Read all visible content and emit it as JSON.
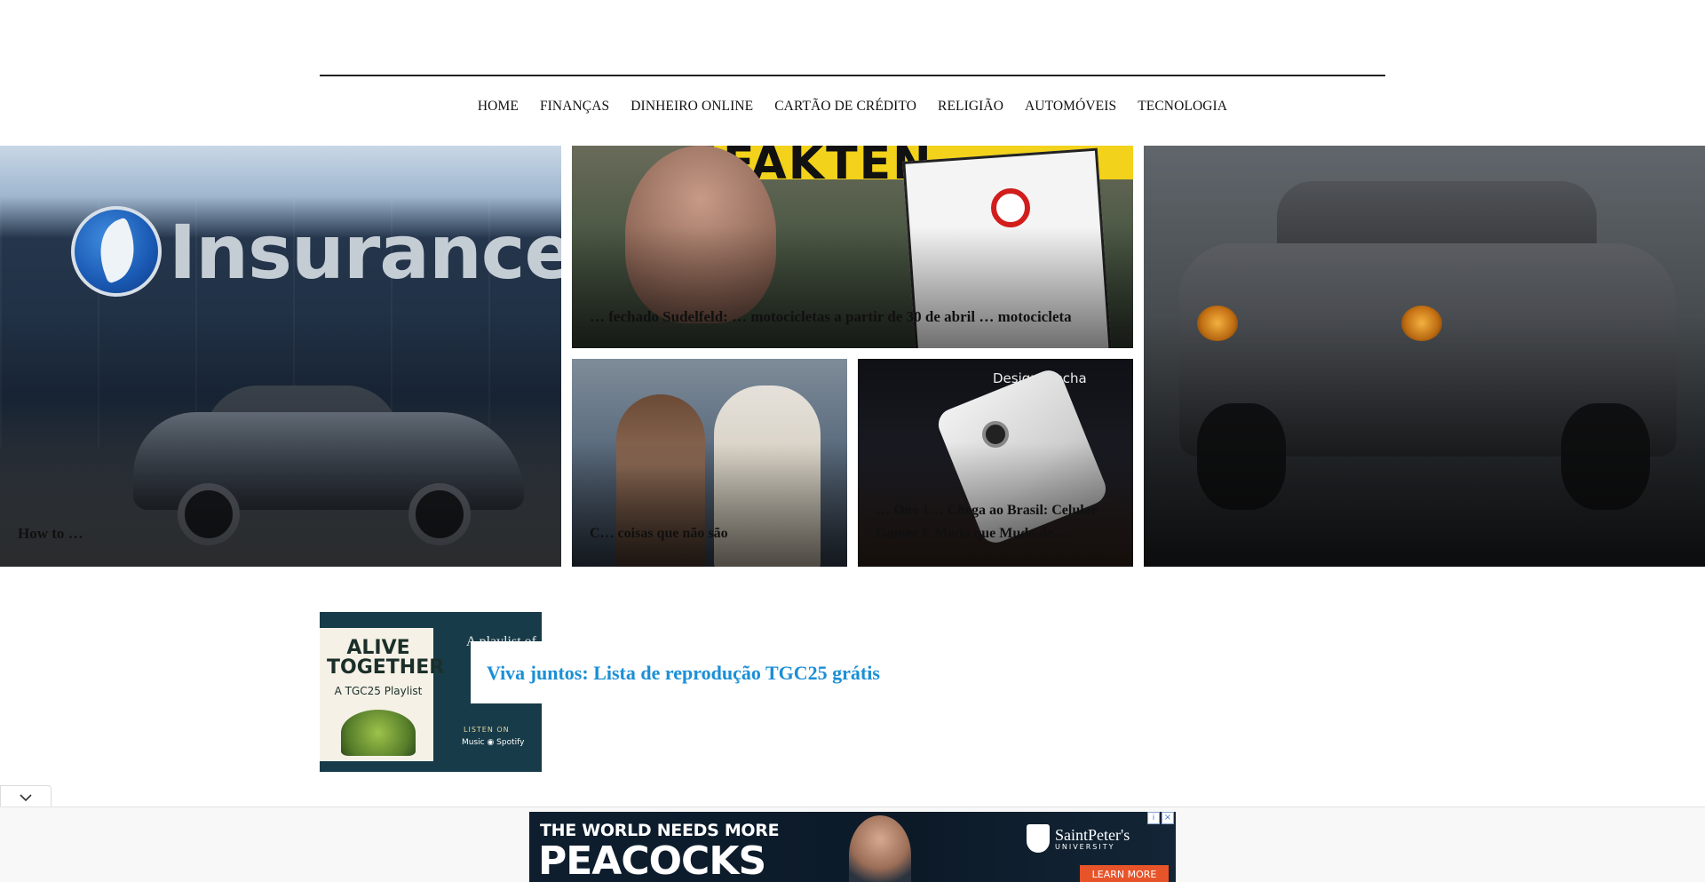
{
  "nav": {
    "items": [
      "HOME",
      "FINANÇAS",
      "DINHEIRO ONLINE",
      "CARTÃO DE CRÉDITO",
      "RELIGIÃO",
      "AUTOMÓVEIS",
      "TECNOLOGIA"
    ]
  },
  "hero": {
    "tiles": [
      {
        "caption": "How to …",
        "logo_text": "Insurance"
      },
      {
        "caption": "… fechado Sudelfeld: … motocicletas a partir de 30 de abril … motocicleta",
        "banner_text": "FAKTEN"
      },
      {
        "caption": "C… coisas que não são"
      },
      {
        "caption": "… One 1… Chega ao Brasil: Celular Gamer E Modo que Muda de…",
        "overlay_text": "Design Mecha"
      },
      {
        "caption": ""
      }
    ]
  },
  "featured": {
    "title": "Viva juntos: Lista de reprodução TGC25 grátis",
    "image_text": {
      "title_line": "ALIVE TOGETHER",
      "subtitle": "A TGC25 Playlist",
      "side_text": "A playlist of the theme.",
      "listen": "LISTEN ON",
      "services": " Music  ◉ Spotify"
    }
  },
  "ad": {
    "line1": "THE WORLD NEEDS MORE",
    "line2": "PEACOCKS",
    "university": "SaintPeter's",
    "university_sub": "UNIVERSITY",
    "cta": "LEARN MORE",
    "adchoices": "i",
    "close": "×"
  },
  "colors": {
    "link_blue": "#1b8fd6",
    "ad_cta": "#e8542a"
  }
}
